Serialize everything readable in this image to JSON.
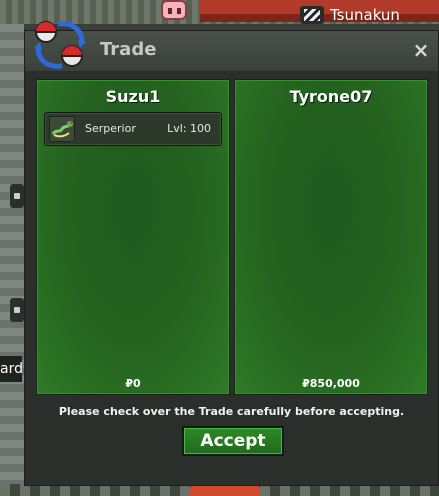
{
  "window": {
    "title": "Trade",
    "close_label": "×"
  },
  "player_tag": {
    "name": "Tsunakun"
  },
  "edge_text": "ard",
  "left_panel": {
    "name": "Suzu1",
    "items": [
      {
        "name": "Serperior",
        "level": "Lvl: 100",
        "icon": "serperior-icon"
      }
    ],
    "money": "₽0"
  },
  "right_panel": {
    "name": "Tyrone07",
    "items": [],
    "money": "₽850,000"
  },
  "notice": "Please check over the Trade carefully before accepting.",
  "accept_label": "Accept"
}
